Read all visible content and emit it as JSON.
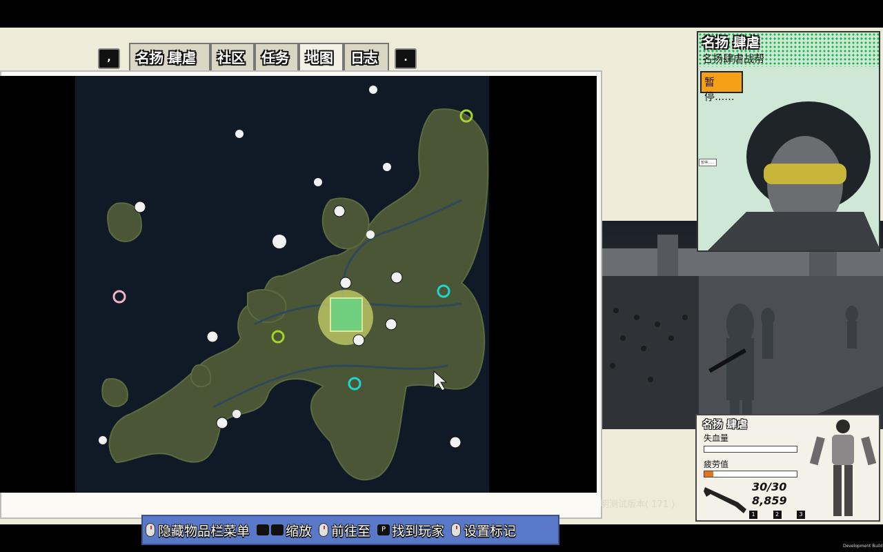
{
  "tabs": {
    "left_key": ",",
    "right_key": ".",
    "items": [
      {
        "label": "名扬 肆虐"
      },
      {
        "label": "社区"
      },
      {
        "label": "任务"
      },
      {
        "label": "地图"
      },
      {
        "label": "日志"
      }
    ],
    "active": "地图"
  },
  "portrait": {
    "name": "名扬 肆虐",
    "gang": "名扬肆虐战帮",
    "pause_label": "暂停......",
    "speech": "暂停......"
  },
  "status": {
    "name": "名扬 肆虐",
    "blood_label": "失血量",
    "fatigue_label": "疲劳值",
    "blood_level": 1.0,
    "fatigue_level": 0.1,
    "ammo": "30/30",
    "money": "8,859",
    "hotkeys": [
      "1",
      "2",
      "3"
    ]
  },
  "version_text": "明测试版本( 171 )",
  "dev_build": "Development Build",
  "hints": [
    {
      "icon": "mouse-icon",
      "label": "隐藏物品栏菜单"
    },
    {
      "icon": "scroll-keys-icon",
      "label": "缩放"
    },
    {
      "icon": "mouse-icon",
      "label": "前往至"
    },
    {
      "icon": "p-key-icon",
      "key": "P",
      "label": "找到玩家"
    },
    {
      "icon": "mouse-icon",
      "label": "设置标记"
    }
  ],
  "colors": {
    "paper": "#eeebd9",
    "map_water": "#0f1a26",
    "map_land": "#4a5636",
    "hint_bar": "#5a78c8",
    "pause_orange": "#f5a016",
    "portrait_green": "#19b84a"
  },
  "map_icons": [
    "skull-icon",
    "money-bag-icon",
    "biohazard-icon",
    "cursor-icon"
  ]
}
